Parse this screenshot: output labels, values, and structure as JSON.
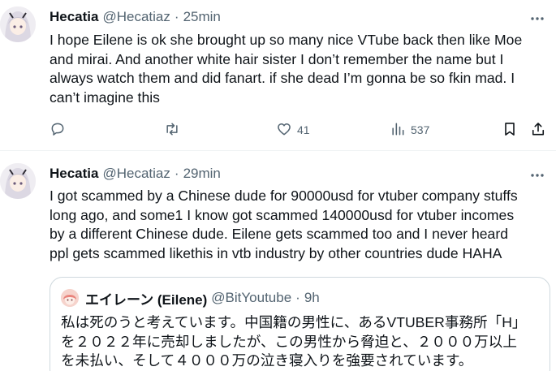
{
  "tweets": [
    {
      "author": {
        "name": "Hecatia",
        "handle": "@Hecatiaz",
        "time": "25min"
      },
      "dot": "·",
      "text": "I hope Eilene is ok she brought up so many nice VTube back then like Moe\nand mirai. And another white hair sister I don’t remember the name but I\nalways watch them and did fanart. if she dead I’m gonna be so fkin mad. I\ncan’t imagine this",
      "actions": {
        "likes": "41",
        "views": "537"
      }
    },
    {
      "author": {
        "name": "Hecatia",
        "handle": "@Hecatiaz",
        "time": "29min"
      },
      "dot": "·",
      "text": "I got scammed by a Chinese dude for 90000usd for vtuber company stuffs\nlong ago, and some1 I know got scammed 140000usd for vtuber incomes\nby a different Chinese dude. Eilene gets scammed too and I never heard\nppl gets scammed likethis in vtb industry by other countries dude HAHA",
      "quote": {
        "name": "エイレーン (Eilene)",
        "handle": "@BitYoutube",
        "dot": "·",
        "time": "9h",
        "text": "私は死のうと考えています。中国籍の男性に、あるVTUBER事務所「H」\nを２０２２年に売却しましたが、この男性から脅迫と、２０００万以上\nを未払い、そして４０００万の泣き寝入りを強要されています。"
      }
    }
  ],
  "icons": {
    "more": "more-horizontal-icon",
    "reply": "reply-icon",
    "retweet": "retweet-icon",
    "like": "heart-icon",
    "views": "views-bar-chart-icon",
    "bookmark": "bookmark-icon",
    "share": "share-icon"
  },
  "colors": {
    "text": "#0f1419",
    "secondary": "#536471",
    "border": "#cfd9de",
    "divider": "#eff3f4"
  }
}
